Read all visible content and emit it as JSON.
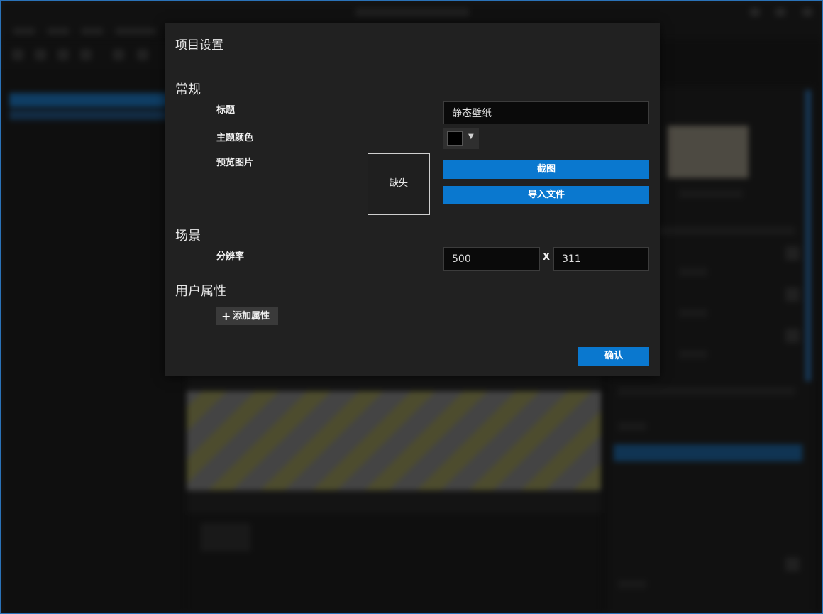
{
  "dialog": {
    "title": "项目设置",
    "sections": {
      "general": "常规",
      "scene": "场景",
      "user_properties": "用户属性"
    },
    "general": {
      "title_label": "标题",
      "title_value": "静态壁纸",
      "theme_color_label": "主题颜色",
      "theme_color_value": "#000000",
      "preview_label": "预览图片",
      "preview_missing": "缺失",
      "screenshot_button": "截图",
      "import_file_button": "导入文件"
    },
    "scene": {
      "resolution_label": "分辨率",
      "width": "500",
      "separator": "X",
      "height": "311"
    },
    "user_properties": {
      "add_button": "添加属性",
      "add_icon": "plus-icon"
    },
    "confirm_button": "确认"
  },
  "colors": {
    "accent": "#0a78cf",
    "dialog_bg": "#212121",
    "input_bg": "#0a0a0a"
  }
}
